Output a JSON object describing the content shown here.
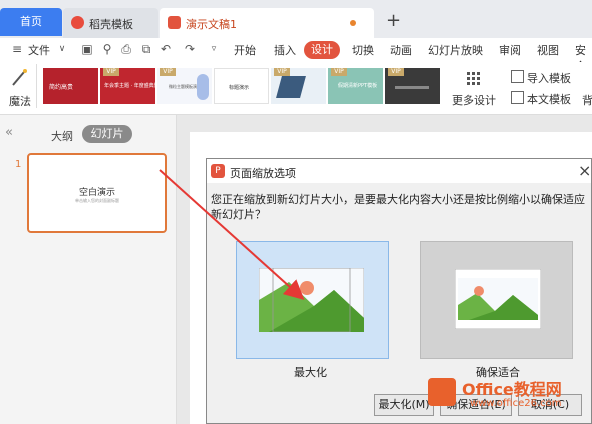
{
  "tabs": {
    "home": "首页",
    "template": "稻壳模板",
    "document": "演示文稿1",
    "new_tab": "+"
  },
  "menu": {
    "file": "文件",
    "start": "开始",
    "insert": "插入",
    "design": "设计",
    "transition": "切换",
    "animation": "动画",
    "slideshow": "幻灯片放映",
    "review": "审阅",
    "view": "视图",
    "security": "安全"
  },
  "ribbon": {
    "magic": "魔法",
    "more_design": "更多设计",
    "import_template": "导入模板",
    "text_template": "本文模板",
    "background": "背",
    "vip": "VIP",
    "template1_text": "简约高贵",
    "template2_text": "年会季主题 · 年度盛典颁奖",
    "template3_text": "微粒主题模板演示",
    "template4_text": "标题演示",
    "template6_text": "假期清新PPT模板"
  },
  "left_panel": {
    "collapse": "«",
    "outline": "大纲",
    "slides": "幻灯片",
    "slide_number": "1",
    "slide_title": "空白演示",
    "slide_subtitle": "单击输入您的封面副标题"
  },
  "dialog": {
    "title": "页面缩放选项",
    "close": "×",
    "message": "您正在缩放到新幻灯片大小，是要最大化内容大小还是按比例缩小以确保适应新幻灯片？",
    "option_maximize": "最大化",
    "option_fit": "确保适合",
    "btn_maximize": "最大化(M)",
    "btn_fit": "确保适合(E)",
    "btn_cancel": "取消(C)"
  },
  "watermark": {
    "brand": "Office教程网",
    "url": "www.office26.com"
  },
  "colors": {
    "accent": "#e2543e",
    "home_tab": "#3c7df0",
    "selection": "#cfe3f7",
    "arrow": "#e53935"
  }
}
